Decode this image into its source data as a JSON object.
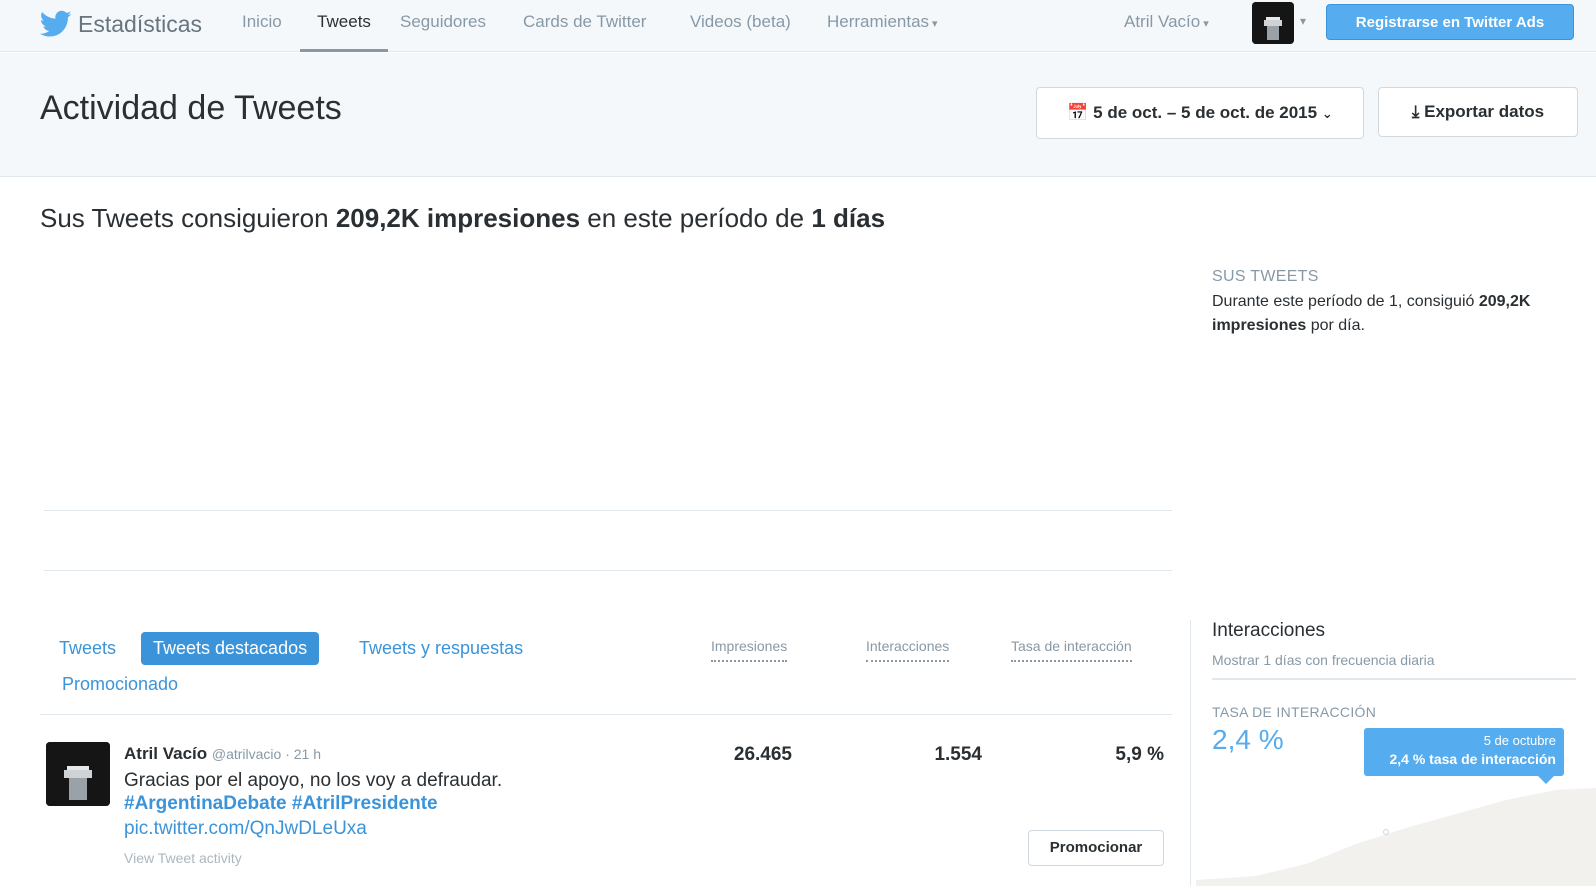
{
  "nav": {
    "brand": "Estadísticas",
    "items": [
      "Inicio",
      "Tweets",
      "Seguidores",
      "Cards de Twitter",
      "Videos (beta)",
      "Herramientas"
    ],
    "active_item": "Tweets",
    "user": "Atril Vacío",
    "ads_button": "Registrarse en Twitter Ads"
  },
  "header": {
    "title": "Actividad de Tweets",
    "date_range": "5 de oct. – 5 de oct. de 2015",
    "export": "Exportar datos"
  },
  "summary": {
    "prefix": "Sus Tweets consiguieron ",
    "impressions": "209,2K impresiones",
    "middle": " en este período de ",
    "days": "1 días"
  },
  "side": {
    "label": "SUS TWEETS",
    "text_prefix": "Durante este período de 1, consiguió ",
    "text_bold": "209,2K impresiones",
    "text_suffix": " por día."
  },
  "tabs": [
    "Tweets",
    "Tweets destacados",
    "Tweets y respuestas",
    "Promocionado"
  ],
  "active_tab": "Tweets destacados",
  "columns": [
    "Impresiones",
    "Interacciones",
    "Tasa de interacción"
  ],
  "tweet": {
    "author": "Atril Vacío",
    "handle_time": "@atrilvacio · 21 h",
    "text": "Gracias por el apoyo, no los voy a defraudar.",
    "hashtags": "#ArgentinaDebate #AtrilPresidente",
    "link": "pic.twitter.com/QnJwDLeUxa",
    "activity": "View Tweet activity",
    "impressions": "26.465",
    "interactions": "1.554",
    "rate": "5,9 %",
    "promote": "Promocionar"
  },
  "interactions_panel": {
    "title": "Interacciones",
    "subtitle": "Mostrar 1 días con frecuencia diaria",
    "rate_label": "TASA DE INTERACCIÓN",
    "rate_value": "2,4 %",
    "tooltip_date": "5 de octubre",
    "tooltip_value": "2,4 % tasa de interacción"
  },
  "colors": {
    "accent": "#55acee",
    "link": "#3b94d9",
    "muted": "#8899a6"
  }
}
